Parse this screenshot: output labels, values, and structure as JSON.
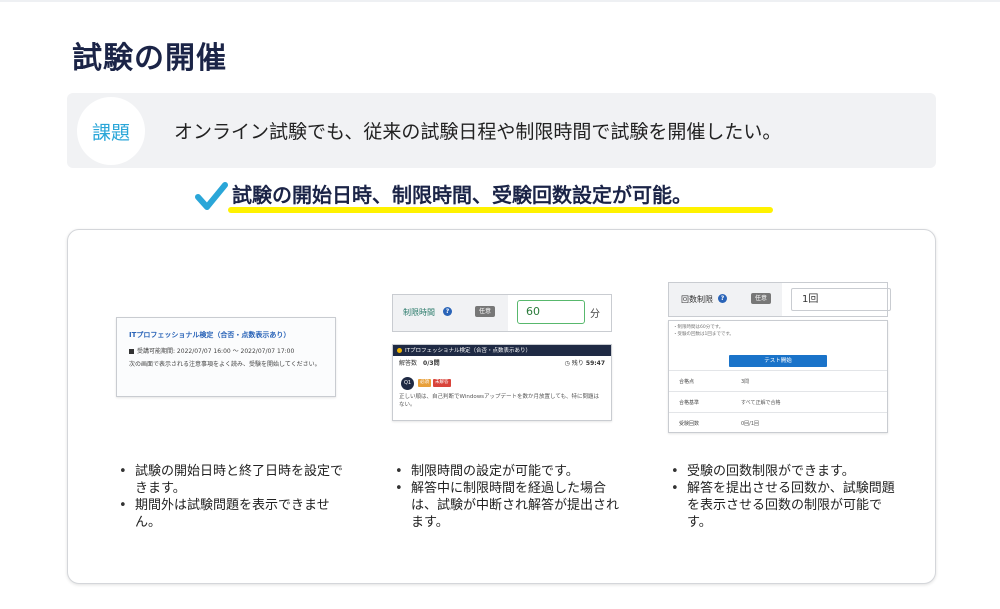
{
  "title": "試験の開催",
  "issue": {
    "badge": "課題",
    "text": "オンライン試験でも、従来の試験日程や制限時間で試験を開催したい。"
  },
  "headline": "試験の開始日時、制限時間、受験回数設定が可能。",
  "colors": {
    "accent": "#2aa6d8",
    "highlight": "#fff200",
    "title": "#1b2447"
  },
  "panel1": {
    "shot": {
      "title": "ITプロフェッショナル検定（合否・点数表示あり）",
      "period": "受講可能期間: 2022/07/07 16:00 ～ 2022/07/07 17:00",
      "note": "次の画面で表示される注意事項をよく読み、受験を開始してください。"
    },
    "bullets": [
      "試験の開始日時と終了日時を設定できます。",
      "期間外は試験問題を表示できません。"
    ]
  },
  "panel2": {
    "setting": {
      "label": "制限時間",
      "badge": "任意",
      "value": "60",
      "unit": "分"
    },
    "exam": {
      "title": "ITプロフェッショナル検定（合否・点数表示あり）",
      "progress_label": "解答数",
      "progress": "0/3問",
      "timer_label": "残り",
      "timer": "59:47",
      "question_no": "Q1",
      "chip1": "必須",
      "chip2": "未解答",
      "body": "正しい順は、自己判断でWindowsアップデートを数か月放置しても、特に問題はない。"
    },
    "bullets": [
      "制限時間の設定が可能です。",
      "解答中に制限時間を経過した場合は、試験が中断され解答が提出されます。"
    ]
  },
  "panel3": {
    "setting": {
      "label": "回数制限",
      "badge": "任意",
      "value": "1回"
    },
    "detail": {
      "note1": "・制限時間は60分です。",
      "note2": "・受験の回数は1回までです。",
      "button": "テスト開始",
      "rows": [
        {
          "k": "合格点",
          "v": "3問"
        },
        {
          "k": "合格基準",
          "v": "すべて正解で合格"
        },
        {
          "k": "受験回数",
          "v": "0回/1回"
        }
      ]
    },
    "bullets": [
      "受験の回数制限ができます。",
      "解答を提出させる回数か、試験問題を表示させる回数の制限が可能です。"
    ]
  }
}
